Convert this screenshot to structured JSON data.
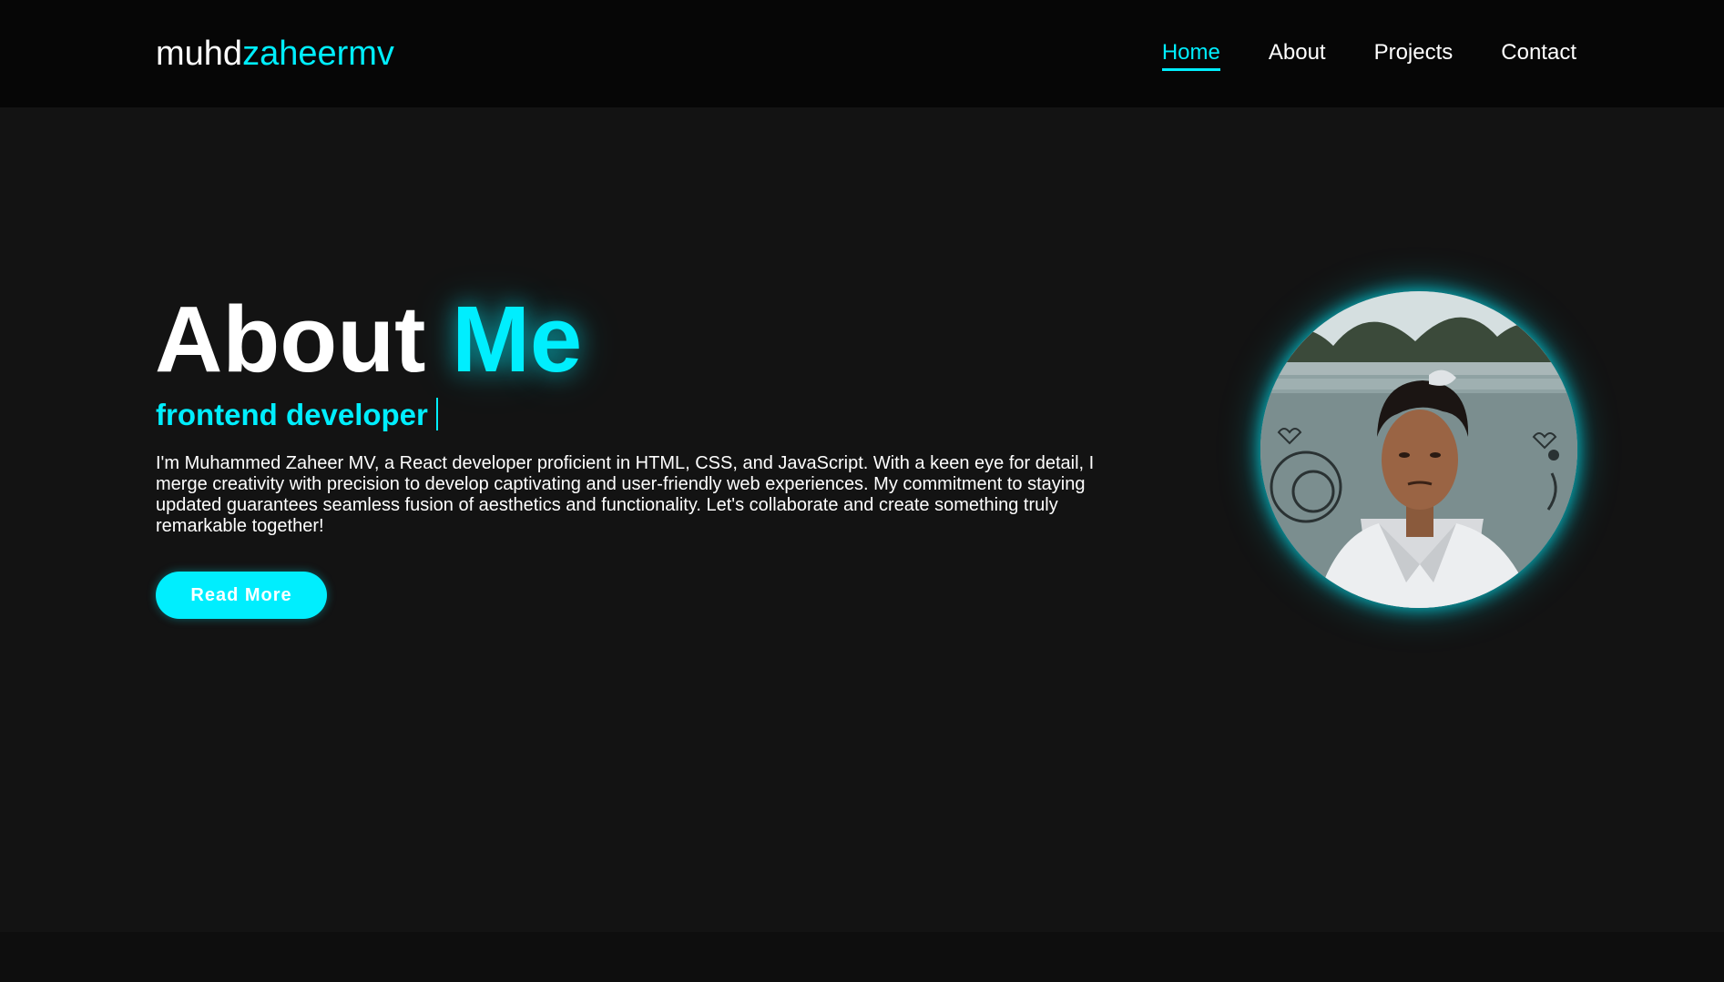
{
  "brand": {
    "logo_part1": "muhd",
    "logo_part2": "zaheermv",
    "accent_color": "#00eefe"
  },
  "nav": {
    "items": [
      {
        "label": "Home",
        "active": true
      },
      {
        "label": "About",
        "active": false
      },
      {
        "label": "Projects",
        "active": false
      },
      {
        "label": "Contact",
        "active": false
      }
    ]
  },
  "hero": {
    "title_part1": "About",
    "title_part2": "Me",
    "subtitle": "frontend developer",
    "bio": "I'm Muhammed Zaheer MV, a React developer proficient in HTML, CSS, and JavaScript. With a keen eye for detail, I merge creativity with precision to develop captivating and user-friendly web experiences. My commitment to staying updated guarantees seamless fusion of aesthetics and functionality. Let's collaborate and create something truly remarkable together!",
    "button_label": "Read More"
  },
  "colors": {
    "background": "#131313",
    "header_background": "#060606",
    "text": "#ffffff",
    "accent": "#00eefe"
  }
}
